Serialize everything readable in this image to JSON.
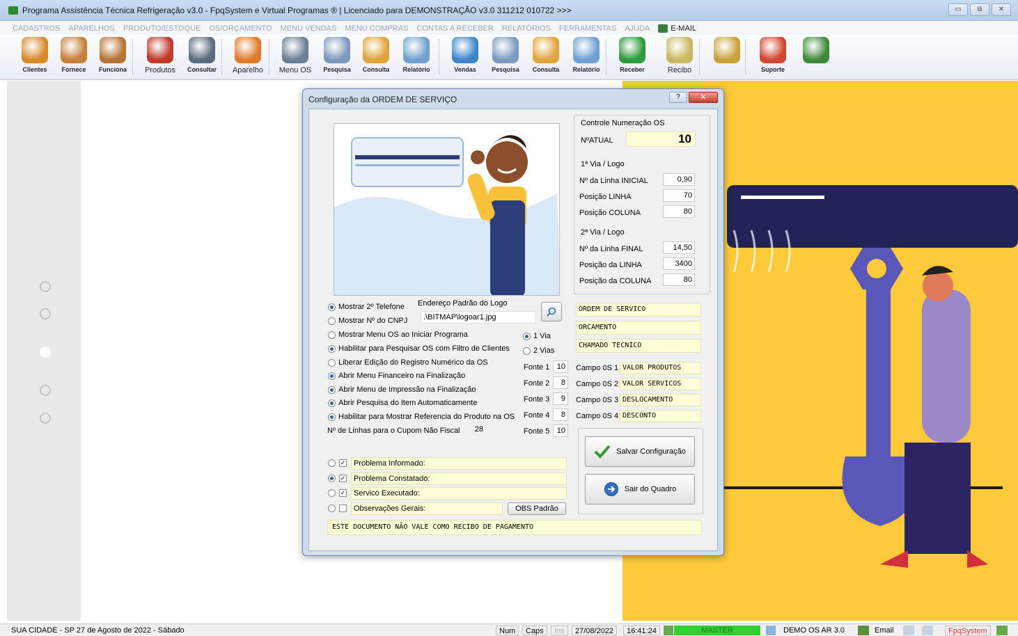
{
  "window": {
    "title": "Programa Assistência Técnica Refrigeração v3.0 - FpqSystem e Virtual Programas ® | Licenciado para  DEMONSTRAÇÃO v3.0 311212 010722 >>>",
    "controls": [
      "▭",
      "⧉",
      "✕"
    ]
  },
  "menu": {
    "items": [
      "CADASTROS",
      "APARELHOS",
      "PRODUTO/ESTOQUE",
      "OS/ORÇAMENTO",
      "MENU VENDAS",
      "MENU COMPRAS",
      "CONTAS A RECEBER",
      "RELATÓRIOS",
      "FERRAMENTAS",
      "AJUDA"
    ],
    "email": "E-MAIL"
  },
  "toolbar": {
    "buttons": [
      {
        "label": "Clientes",
        "icon": "clients-icon",
        "color": "#d9892b"
      },
      {
        "label": "Fornece",
        "icon": "supplier-icon",
        "color": "#c87f3a"
      },
      {
        "label": "Funciona",
        "icon": "employee-icon",
        "color": "#b87334"
      },
      {
        "label": "Produtos",
        "icon": "products-icon",
        "color": "#c0392b"
      },
      {
        "label": "Consultar",
        "icon": "consult-icon",
        "color": "#5a6b7d"
      },
      {
        "label": "Aparelho",
        "icon": "appliance-icon",
        "color": "#e07a2a"
      },
      {
        "label": "Menu OS",
        "icon": "tools-icon",
        "color": "#6a7f95"
      },
      {
        "label": "Pesquisa",
        "icon": "search-docs-icon",
        "color": "#7c9abf"
      },
      {
        "label": "Consulta",
        "icon": "folder-icon",
        "color": "#e0a43a"
      },
      {
        "label": "Relatório",
        "icon": "report-icon",
        "color": "#6fa0d0"
      },
      {
        "label": "Vendas",
        "icon": "monitor-icon",
        "color": "#3d86c9"
      },
      {
        "label": "Pesquisa",
        "icon": "search-docs-icon",
        "color": "#7c9abf"
      },
      {
        "label": "Consulta",
        "icon": "folder-icon",
        "color": "#e0a43a"
      },
      {
        "label": "Relatório",
        "icon": "report-icon",
        "color": "#6fa0d0"
      },
      {
        "label": "Receber",
        "icon": "money-icon",
        "color": "#2e9b3a"
      },
      {
        "label": "Recibo",
        "icon": "receipt-icon",
        "color": "#c8b860"
      },
      {
        "label": "",
        "icon": "coins-icon",
        "color": "#c9a23a"
      },
      {
        "label": "Suporte",
        "icon": "support-icon",
        "color": "#d2452e"
      },
      {
        "label": "",
        "icon": "exit-icon",
        "color": "#3f8a3a"
      }
    ]
  },
  "dialog": {
    "title": "Configuração da ORDEM DE SERVIÇO",
    "help": "?",
    "close": "✕",
    "numbering": {
      "header": "Controle Numeração OS",
      "current_label": "NºATUAL",
      "current_value": "10"
    },
    "via1": {
      "header": "1ª Via / Logo",
      "rows": [
        {
          "label": "Nº da Linha INICIAL",
          "value": "0,90"
        },
        {
          "label": "Posição LINHA",
          "value": "70"
        },
        {
          "label": "Posição COLUNA",
          "value": "80"
        }
      ]
    },
    "via2": {
      "header": "2ª Via / Logo",
      "rows": [
        {
          "label": "Nº da Linha FINAL",
          "value": "14,50"
        },
        {
          "label": "Posição da LINHA",
          "value": "3400"
        },
        {
          "label": "Posição da COLUNA",
          "value": "80"
        }
      ]
    },
    "doc_titles": [
      "ORDEM DE SERVICO",
      "ORCAMENTO",
      "CHAMADO TECNICO"
    ],
    "phone_options": [
      {
        "label": "Mostrar 2º Telefone",
        "checked": true
      },
      {
        "label": "Mostrar Nº do CNPJ",
        "checked": false
      }
    ],
    "logo": {
      "label": "Endereço Padrão do Logo",
      "path": ".\\BITMAP\\logoar1.jpg"
    },
    "options": [
      {
        "label": "Mostrar Menu OS ao Iniciar Programa",
        "checked": false
      },
      {
        "label": "Habilitar para Pesquisar OS com Filtro de Clientes",
        "checked": true
      },
      {
        "label": "Liberar Edição do Registro Numérico da OS",
        "checked": false
      },
      {
        "label": "Abrir Menu Financeiro na Finalização",
        "checked": true
      },
      {
        "label": "Abrir Menu de Impressão na Finalização",
        "checked": true
      },
      {
        "label": "Abrir Pesquisa do Item Automaticamente",
        "checked": true
      },
      {
        "label": "Habilitar para Mostrar Referencia do Produto na OS",
        "checked": true
      }
    ],
    "vias": [
      {
        "label": "1 Via",
        "checked": true
      },
      {
        "label": "2 Vias",
        "checked": false
      }
    ],
    "cupom": {
      "label": "Nº de Linhas para o Cupom Não Fiscal",
      "value": "28"
    },
    "fonts": [
      {
        "label": "Fonte 1",
        "value": "10"
      },
      {
        "label": "Fonte 2",
        "value": "8"
      },
      {
        "label": "Fonte 3",
        "value": "9"
      },
      {
        "label": "Fonte 4",
        "value": "8"
      },
      {
        "label": "Fonte 5",
        "value": "10"
      }
    ],
    "campos": [
      {
        "label": "Campo 0S 1",
        "value": "VALOR PRODUTOS"
      },
      {
        "label": "Campo 0S 2",
        "value": "VALOR SERVICOS"
      },
      {
        "label": "Campo 0S 3",
        "value": "DESLOCAMENTO"
      },
      {
        "label": "Campo 0S 4",
        "value": "DESCONTO"
      }
    ],
    "save_button": "Salvar Configuração",
    "exit_button": "Sair do Quadro",
    "problem_fields": [
      {
        "label": "Problema Informado:",
        "radio": false,
        "checked": true
      },
      {
        "label": "Problema Constatado:",
        "radio": true,
        "checked": true
      },
      {
        "label": "Servico Executado:",
        "radio": false,
        "checked": true
      },
      {
        "label": "Observações Gerais:",
        "radio": false,
        "checked": false
      }
    ],
    "obs_button": "OBS Padrão",
    "footer_text": "ESTE DOCUMENTO NÃO VALE COMO RECIBO DE PAGAMENTO"
  },
  "statusbar": {
    "location": "SUA CIDADE - SP 27 de Agosto de 2022 - Sábado",
    "num": "Num",
    "caps": "Caps",
    "ins": "Ins",
    "date": "27/08/2022",
    "time": "16:41:24",
    "user": "MASTER",
    "version": "DEMO OS AR 3.0",
    "email": "Email",
    "brand": "FpqSystem"
  }
}
